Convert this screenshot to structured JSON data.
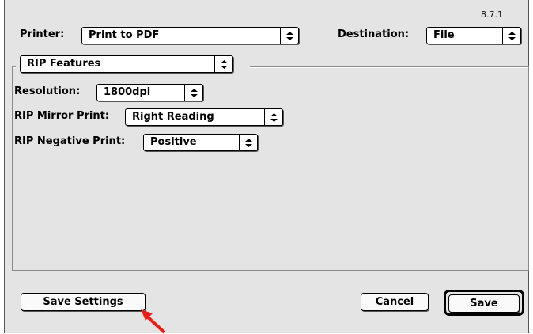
{
  "version": "8.7.1",
  "printer": {
    "label": "Printer:",
    "value": "Print to PDF"
  },
  "destination": {
    "label": "Destination:",
    "value": "File"
  },
  "section": {
    "value": "RIP Features"
  },
  "resolution": {
    "label": "Resolution:",
    "value": "1800dpi"
  },
  "mirror": {
    "label": "RIP Mirror Print:",
    "value": "Right Reading"
  },
  "negative": {
    "label": "RIP Negative Print:",
    "value": "Positive"
  },
  "buttons": {
    "save_settings": "Save Settings",
    "cancel": "Cancel",
    "save": "Save"
  },
  "annotation_color": "#e8201a",
  "icons": [
    "updown-arrows-icon",
    "annotation-arrow-icon"
  ]
}
